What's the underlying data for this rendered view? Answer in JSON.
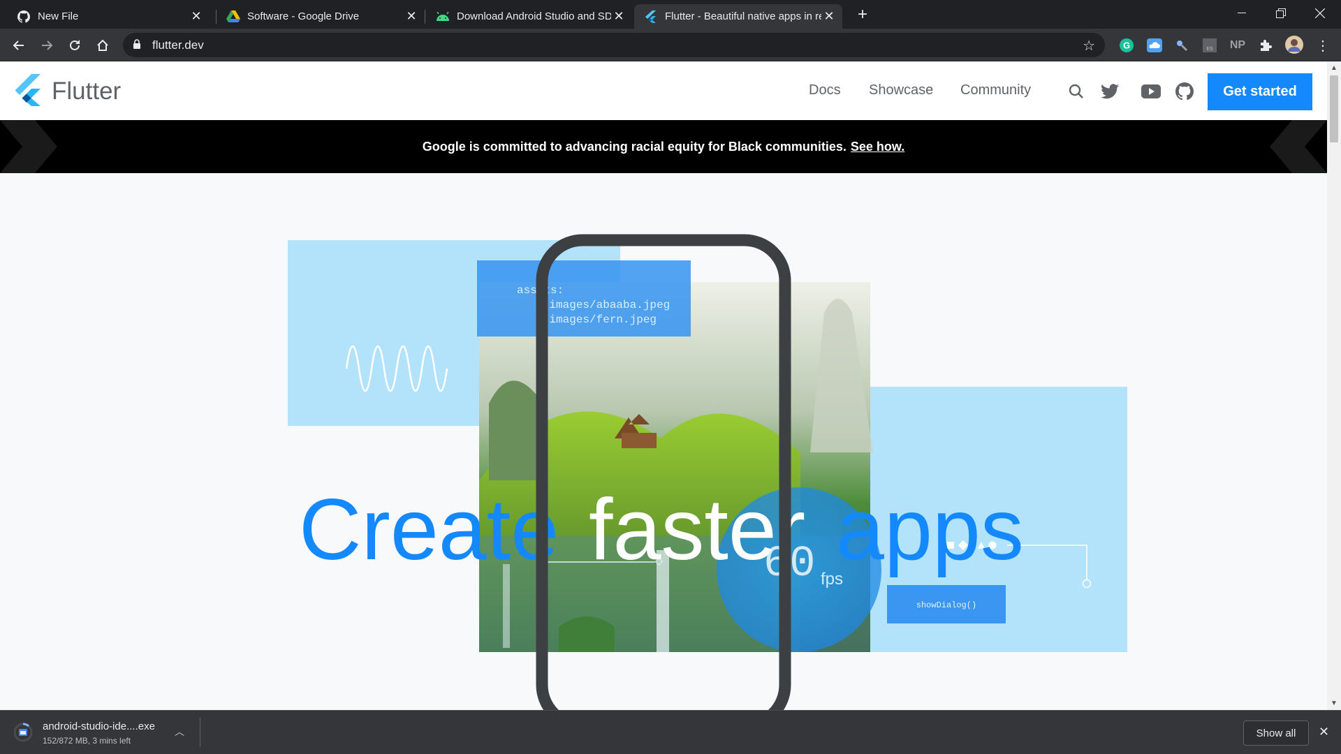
{
  "browser": {
    "tabs": [
      {
        "title": "New File",
        "icon": "github-icon"
      },
      {
        "title": "Software - Google Drive",
        "icon": "google-drive-icon"
      },
      {
        "title": "Download Android Studio and SDK tools",
        "icon": "android-icon"
      },
      {
        "title": "Flutter - Beautiful native apps in record time",
        "icon": "flutter-icon",
        "active": true
      }
    ],
    "url": "flutter.dev",
    "extensions": [
      "grammarly-icon",
      "cloud-icon",
      "key-icon",
      "es-icon",
      "NP",
      "puzzle-icon",
      "avatar"
    ]
  },
  "site": {
    "brand": "Flutter",
    "nav": [
      "Docs",
      "Showcase",
      "Community"
    ],
    "cta": "Get started",
    "banner_text": "Google is committed to advancing racial equity for Black communities.",
    "banner_link": "See how."
  },
  "hero": {
    "headline_1": "Create",
    "headline_2": "faster",
    "headline_3": "apps",
    "code_line_1": "assets:",
    "code_line_2": "  - images/abaaba.jpeg",
    "code_line_3": "  - images/fern.jpeg",
    "fps_value": "60",
    "fps_unit": "fps",
    "dialog_code": "showDialog()"
  },
  "download": {
    "filename": "android-studio-ide....exe",
    "status": "152/872 MB, 3 mins left",
    "show_all": "Show all"
  },
  "colors": {
    "flutter_blue": "#1389fd",
    "light_blue": "#b3e3fb",
    "chrome_dark": "#202124",
    "chrome_toolbar": "#35363a"
  }
}
